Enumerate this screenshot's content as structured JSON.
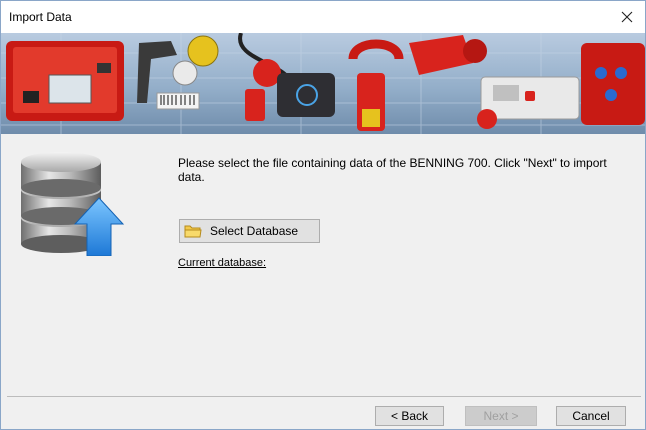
{
  "window": {
    "title": "Import Data"
  },
  "content": {
    "instructions": "Please select the file containing data of the BENNING 700. Click \"Next\" to import data.",
    "select_database_label": "Select Database",
    "current_database_label": "Current database:"
  },
  "buttons": {
    "back": "< Back",
    "next": "Next >",
    "cancel": "Cancel"
  },
  "colors": {
    "accent_red": "#d8231d",
    "banner_blue": "#93aec9",
    "upload_arrow": "#2a8fe0"
  },
  "icons": [
    "close-icon",
    "database-upload-icon",
    "folder-icon"
  ]
}
